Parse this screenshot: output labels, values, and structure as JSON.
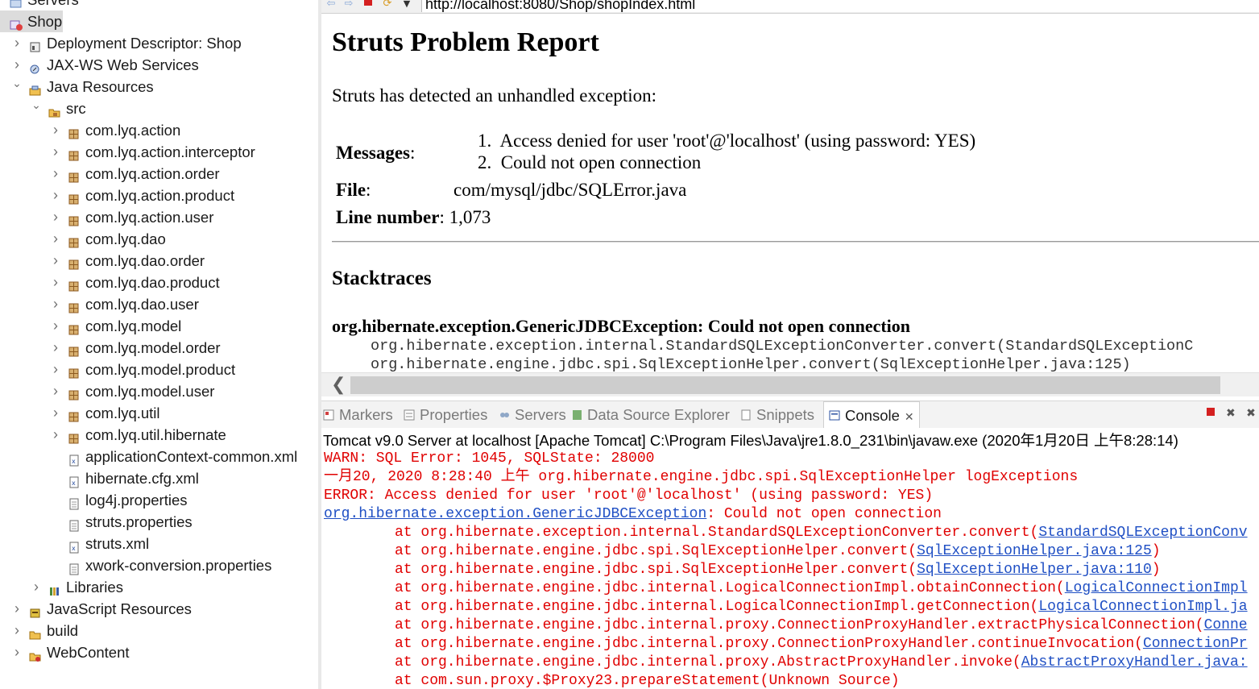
{
  "explorer": {
    "top_partial": "Servers",
    "project": "Shop",
    "items": [
      {
        "label": "Deployment Descriptor: Shop",
        "arrow": "›",
        "icon": "deployment-descriptor-icon"
      },
      {
        "label": "JAX-WS Web Services",
        "arrow": "›",
        "icon": "web-services-icon"
      },
      {
        "label": "Java Resources",
        "arrow": "⌄",
        "icon": "java-resources-icon"
      },
      {
        "label": "src",
        "arrow": "⌄",
        "icon": "source-folder-icon"
      },
      {
        "label": "com.lyq.action",
        "arrow": "›",
        "icon": "package-icon"
      },
      {
        "label": "com.lyq.action.interceptor",
        "arrow": "›",
        "icon": "package-icon"
      },
      {
        "label": "com.lyq.action.order",
        "arrow": "›",
        "icon": "package-icon"
      },
      {
        "label": "com.lyq.action.product",
        "arrow": "›",
        "icon": "package-icon"
      },
      {
        "label": "com.lyq.action.user",
        "arrow": "›",
        "icon": "package-icon"
      },
      {
        "label": "com.lyq.dao",
        "arrow": "›",
        "icon": "package-icon"
      },
      {
        "label": "com.lyq.dao.order",
        "arrow": "›",
        "icon": "package-icon"
      },
      {
        "label": "com.lyq.dao.product",
        "arrow": "›",
        "icon": "package-icon"
      },
      {
        "label": "com.lyq.dao.user",
        "arrow": "›",
        "icon": "package-icon"
      },
      {
        "label": "com.lyq.model",
        "arrow": "›",
        "icon": "package-icon"
      },
      {
        "label": "com.lyq.model.order",
        "arrow": "›",
        "icon": "package-icon"
      },
      {
        "label": "com.lyq.model.product",
        "arrow": "›",
        "icon": "package-icon"
      },
      {
        "label": "com.lyq.model.user",
        "arrow": "›",
        "icon": "package-icon"
      },
      {
        "label": "com.lyq.util",
        "arrow": "›",
        "icon": "package-icon"
      },
      {
        "label": "com.lyq.util.hibernate",
        "arrow": "›",
        "icon": "package-icon"
      },
      {
        "label": "applicationContext-common.xml",
        "arrow": "",
        "icon": "xml-file-icon"
      },
      {
        "label": "hibernate.cfg.xml",
        "arrow": "",
        "icon": "xml-file-icon"
      },
      {
        "label": "log4j.properties",
        "arrow": "",
        "icon": "properties-file-icon"
      },
      {
        "label": "struts.properties",
        "arrow": "",
        "icon": "properties-file-icon"
      },
      {
        "label": "struts.xml",
        "arrow": "",
        "icon": "xml-file-icon"
      },
      {
        "label": "xwork-conversion.properties",
        "arrow": "",
        "icon": "properties-file-icon"
      },
      {
        "label": "Libraries",
        "arrow": "›",
        "icon": "libraries-icon"
      },
      {
        "label": "JavaScript Resources",
        "arrow": "›",
        "icon": "javascript-resources-icon"
      },
      {
        "label": "build",
        "arrow": "›",
        "icon": "folder-icon"
      },
      {
        "label": "WebContent",
        "arrow": "›",
        "icon": "web-content-folder-icon"
      }
    ]
  },
  "browser": {
    "url": "http://localhost:8080/Shop/shopIndex.html",
    "page": {
      "title": "Struts Problem Report",
      "intro": "Struts has detected an unhandled exception:",
      "messages_label": "Messages",
      "messages": [
        "Access denied for user 'root'@'localhost' (using password: YES)",
        "Could not open connection"
      ],
      "file_label": "File",
      "file_value": "com/mysql/jdbc/SQLError.java",
      "line_label": "Line number",
      "line_value": "1,073",
      "stacktraces_heading": "Stacktraces",
      "exception": "org.hibernate.exception.GenericJDBCException: Could not open connection",
      "trace": [
        "org.hibernate.exception.internal.StandardSQLExceptionConverter.convert(StandardSQLExceptionC",
        "org.hibernate.engine.jdbc.spi.SqlExceptionHelper.convert(SqlExceptionHelper.java:125)"
      ]
    }
  },
  "views": {
    "tabs": [
      {
        "label": "Markers",
        "icon": "markers-icon",
        "active": false
      },
      {
        "label": "Properties",
        "icon": "properties-icon",
        "active": false
      },
      {
        "label": "Servers",
        "icon": "servers-icon",
        "active": false
      },
      {
        "label": "Data Source Explorer",
        "icon": "data-source-icon",
        "active": false
      },
      {
        "label": "Snippets",
        "icon": "snippets-icon",
        "active": false
      },
      {
        "label": "Console",
        "icon": "console-icon",
        "active": true
      }
    ],
    "close_glyph": "✕"
  },
  "console": {
    "title": "Tomcat v9.0 Server at localhost [Apache Tomcat] C:\\Program Files\\Java\\jre1.8.0_231\\bin\\javaw.exe (2020年1月20日 上午8:28:14)",
    "lines": [
      {
        "text": "WARN: SQL Error: 1045, SQLState: 28000"
      },
      {
        "text": "一月20, 2020 8:28:40 上午 org.hibernate.engine.jdbc.spi.SqlExceptionHelper logExceptions"
      },
      {
        "text": "ERROR: Access denied for user 'root'@'localhost' (using password: YES)"
      },
      {
        "link": "org.hibernate.exception.GenericJDBCException",
        "text": ": Could not open connection"
      },
      {
        "indent": true,
        "text": "at org.hibernate.exception.internal.StandardSQLExceptionConverter.convert(",
        "link": "StandardSQLExceptionConv",
        "after": ""
      },
      {
        "indent": true,
        "text": "at org.hibernate.engine.jdbc.spi.SqlExceptionHelper.convert(",
        "link": "SqlExceptionHelper.java:125",
        "after": ")"
      },
      {
        "indent": true,
        "text": "at org.hibernate.engine.jdbc.spi.SqlExceptionHelper.convert(",
        "link": "SqlExceptionHelper.java:110",
        "after": ")"
      },
      {
        "indent": true,
        "text": "at org.hibernate.engine.jdbc.internal.LogicalConnectionImpl.obtainConnection(",
        "link": "LogicalConnectionImpl",
        "after": ""
      },
      {
        "indent": true,
        "text": "at org.hibernate.engine.jdbc.internal.LogicalConnectionImpl.getConnection(",
        "link": "LogicalConnectionImpl.ja",
        "after": ""
      },
      {
        "indent": true,
        "text": "at org.hibernate.engine.jdbc.internal.proxy.ConnectionProxyHandler.extractPhysicalConnection(",
        "link": "Conne",
        "after": ""
      },
      {
        "indent": true,
        "text": "at org.hibernate.engine.jdbc.internal.proxy.ConnectionProxyHandler.continueInvocation(",
        "link": "ConnectionPr",
        "after": ""
      },
      {
        "indent": true,
        "text": "at org.hibernate.engine.jdbc.internal.proxy.AbstractProxyHandler.invoke(",
        "link": "AbstractProxyHandler.java:",
        "after": ""
      },
      {
        "indent": true,
        "text": "at com.sun.proxy.$Proxy23.prepareStatement(Unknown Source)"
      }
    ]
  },
  "colors": {
    "console_error": "#e00000",
    "console_link": "#1f4fc4",
    "selection": "#dcdcdc"
  }
}
